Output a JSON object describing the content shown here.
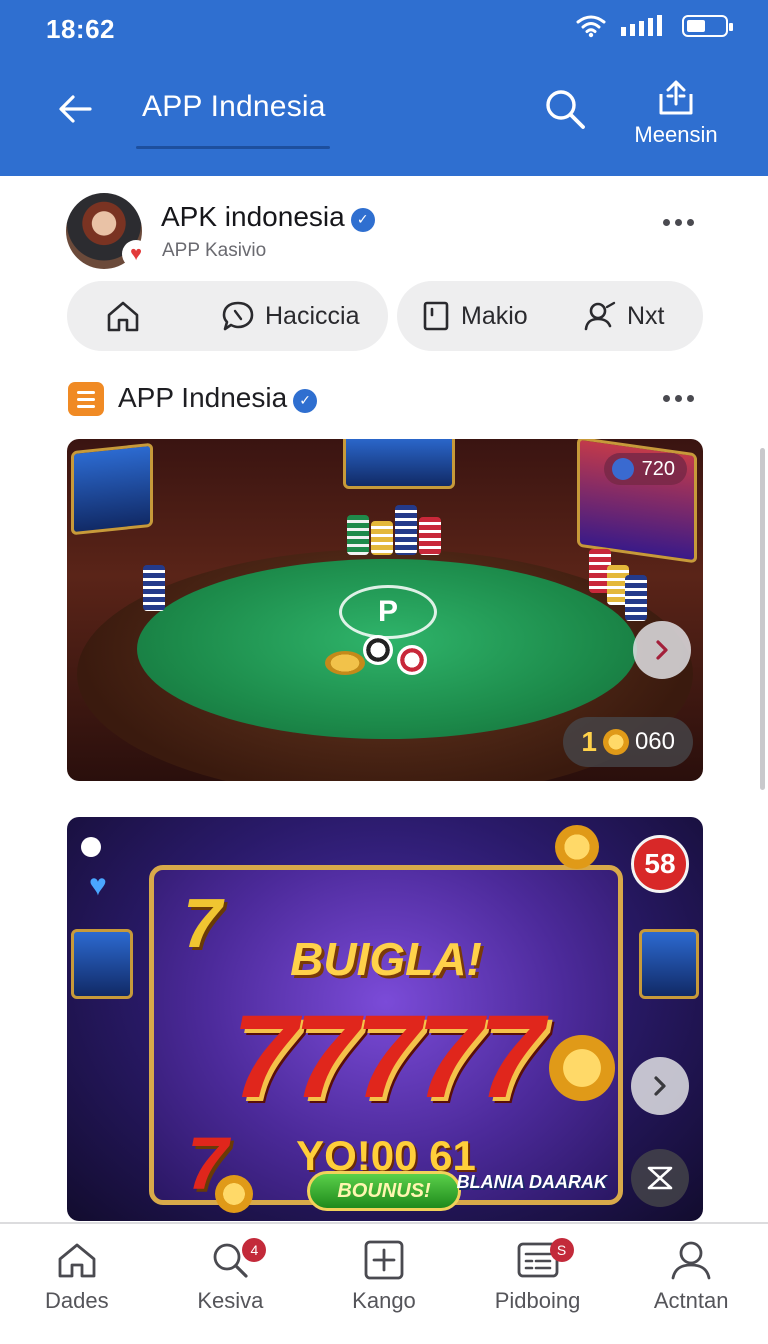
{
  "status_bar": {
    "time": "18:62"
  },
  "header": {
    "title": "APP Indnesia",
    "share_label": "Meensin"
  },
  "profile": {
    "name": "APK indonesia",
    "subtitle": "APP Kasivio"
  },
  "pill_bar": {
    "items": [
      {
        "label": "",
        "icon": "home-icon"
      },
      {
        "label": "Haciccia",
        "icon": "chat-bubble-icon"
      },
      {
        "label": "Makio",
        "icon": "bookmark-icon"
      },
      {
        "label": "Nxt",
        "icon": "users-icon"
      }
    ]
  },
  "section": {
    "title": "APP Indnesia"
  },
  "cards": [
    {
      "badge_count": "720",
      "counter_prefix": "1",
      "counter_value": "060"
    },
    {
      "headline": "BUIGLA!",
      "reels": "77777",
      "amount": "YO!00 61",
      "bonus_label": "BOUNUS!",
      "count_badge": "58",
      "brand": "BLANIA DAARAK"
    }
  ],
  "bottom_nav": {
    "items": [
      {
        "label": "Dades",
        "icon": "home-icon",
        "badge": ""
      },
      {
        "label": "Kesiva",
        "icon": "search-icon",
        "badge": "4"
      },
      {
        "label": "Kango",
        "icon": "add-square-icon",
        "badge": ""
      },
      {
        "label": "Pidboing",
        "icon": "list-card-icon",
        "badge": "S"
      },
      {
        "label": "Actntan",
        "icon": "person-icon",
        "badge": ""
      }
    ]
  },
  "colors": {
    "appbar": "#2f6fd0",
    "section_icon": "#f08a24",
    "badge_red": "#c32a3a"
  }
}
